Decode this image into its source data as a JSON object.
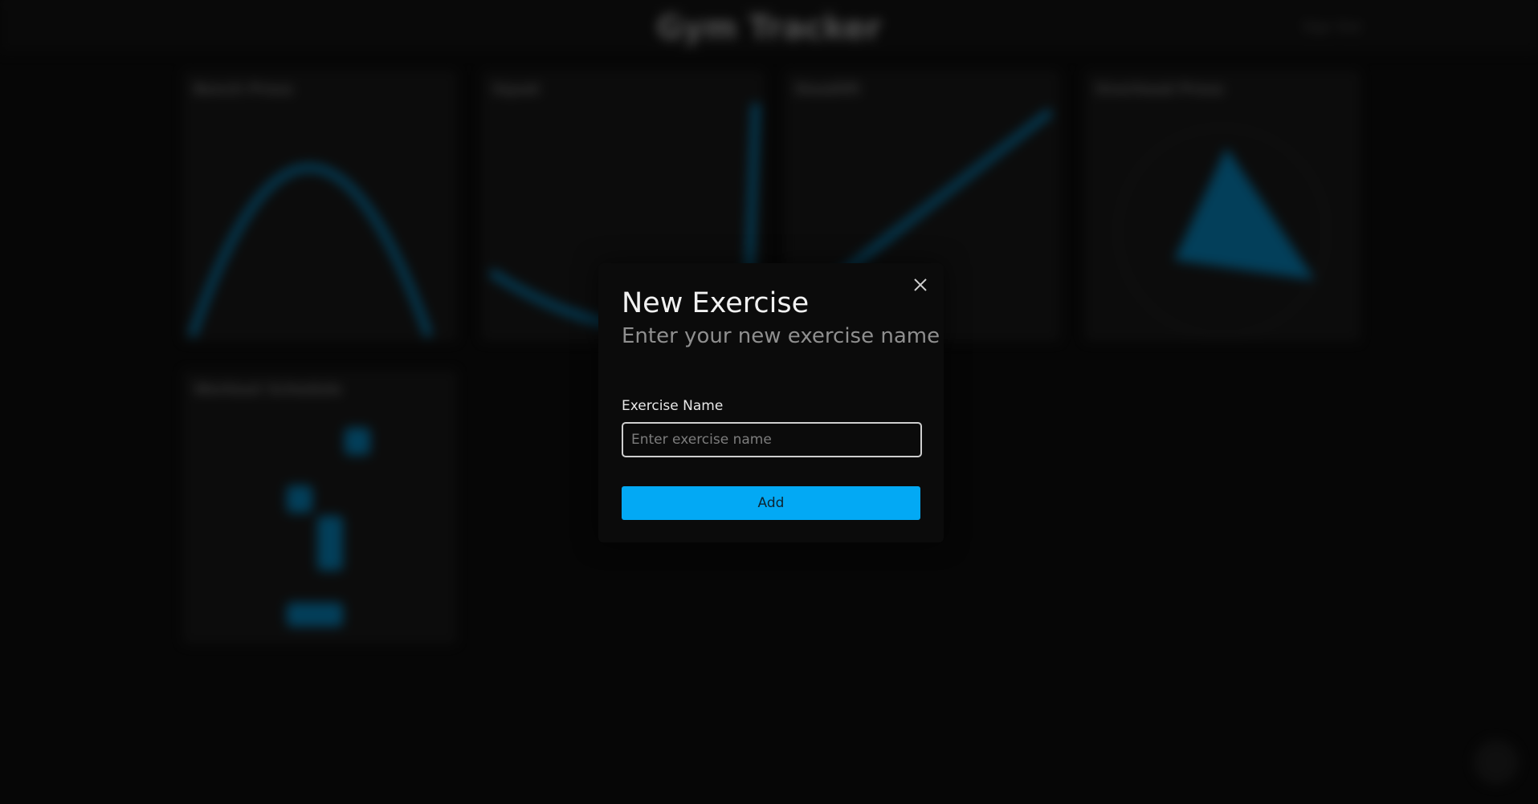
{
  "background": {
    "app_title": "Gym Tracker",
    "header_action": "Sign Out",
    "cards": [
      {
        "title": "Bench Press"
      },
      {
        "title": "Squat"
      },
      {
        "title": "Deadlift"
      },
      {
        "title": "Overhead Press"
      },
      {
        "title": "Workout Schedule"
      }
    ]
  },
  "modal": {
    "title": "New Exercise",
    "subtitle": "Enter your new exercise name",
    "field_label": "Exercise Name",
    "field_placeholder": "Enter exercise name",
    "field_value": "",
    "submit_label": "Add"
  },
  "colors": {
    "accent": "#03a9f4",
    "background": "#0a0a0a",
    "modal_background": "#0b0b0b"
  },
  "icons": {
    "close": "close-icon"
  }
}
